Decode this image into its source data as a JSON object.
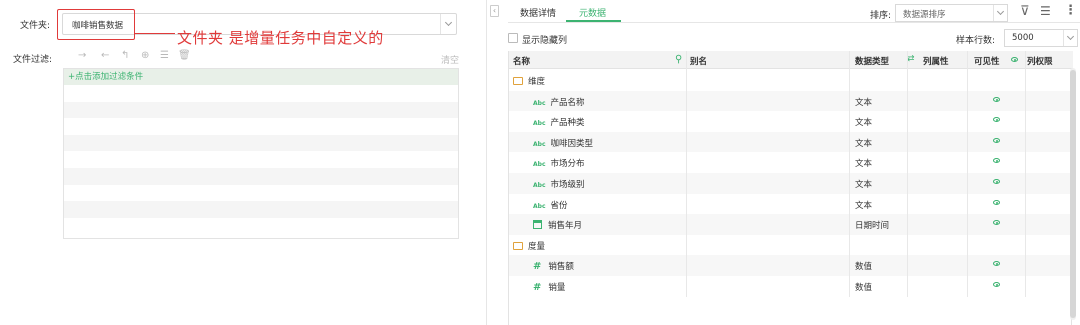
{
  "left": {
    "folder_label": "文件夹:",
    "folder_value": "咖啡销售数据",
    "annotation": "文件夹  是增量任务中自定义的",
    "filter_label": "文件过滤:",
    "toolbar_icons": [
      "arrow-right-icon",
      "arrow-left-icon",
      "indent-icon",
      "add-group-icon",
      "list-icon",
      "delete-icon"
    ],
    "clear_label": "清空",
    "add_filter": "+点击添加过滤条件"
  },
  "right": {
    "tabs": [
      {
        "label": "数据详情",
        "active": false
      },
      {
        "label": "元数据",
        "active": true
      }
    ],
    "sort_label": "排序:",
    "sort_value": "数据源排序",
    "show_hidden": "显示隐藏列",
    "sample_label": "样本行数:",
    "sample_value": "5000",
    "columns": {
      "name": "名称",
      "alias": "别名",
      "datatype": "数据类型",
      "attr": "列属性",
      "visible": "可见性",
      "perm": "列权限"
    },
    "rows": [
      {
        "kind": "folder",
        "name": "维度",
        "type": "",
        "visible": false
      },
      {
        "kind": "abc",
        "icon_text": "Abc",
        "name": "产品名称",
        "type": "文本",
        "visible": true
      },
      {
        "kind": "abc",
        "icon_text": "Abc",
        "name": "产品种类",
        "type": "文本",
        "visible": true
      },
      {
        "kind": "abc",
        "icon_text": "Abc",
        "name": "咖啡因类型",
        "type": "文本",
        "visible": true
      },
      {
        "kind": "abc",
        "icon_text": "Abc",
        "name": "市场分布",
        "type": "文本",
        "visible": true
      },
      {
        "kind": "abc",
        "icon_text": "Abc",
        "name": "市场级别",
        "type": "文本",
        "visible": true
      },
      {
        "kind": "abc",
        "icon_text": "Abc",
        "name": "省份",
        "type": "文本",
        "visible": true
      },
      {
        "kind": "date",
        "name": "销售年月",
        "type": "日期时间",
        "visible": true
      },
      {
        "kind": "folder",
        "name": "度量",
        "type": "",
        "visible": false
      },
      {
        "kind": "num",
        "icon_text": "#",
        "name": "销售额",
        "type": "数值",
        "visible": true
      },
      {
        "kind": "num",
        "icon_text": "#",
        "name": "销量",
        "type": "数值",
        "visible": true
      }
    ]
  },
  "colors": {
    "accent": "#3cb371",
    "annotation": "#e03a3a"
  }
}
